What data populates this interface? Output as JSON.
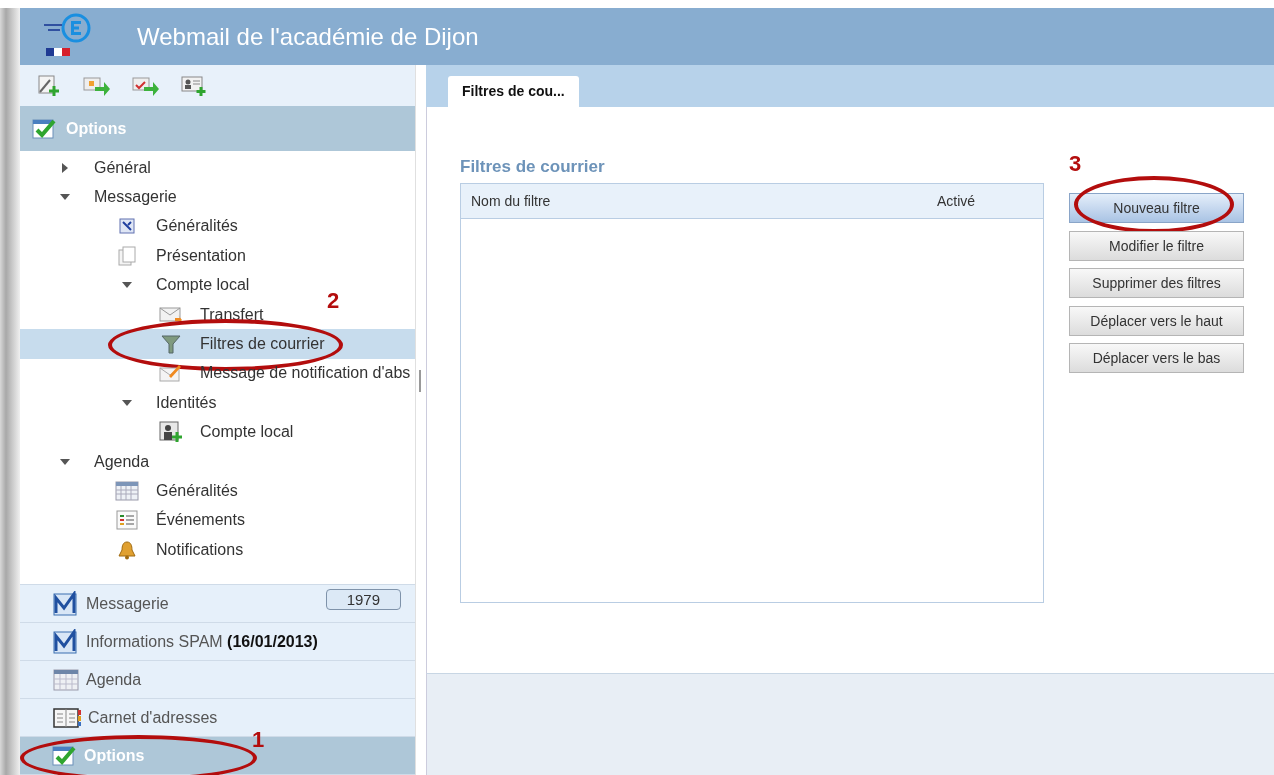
{
  "header": {
    "title": "Webmail de l'académie de Dijon"
  },
  "panel": {
    "title": "Options"
  },
  "tree": [
    {
      "label": "Général",
      "kind": "section",
      "expanded": false,
      "selected": false
    },
    {
      "label": "Messagerie",
      "kind": "section",
      "expanded": true,
      "selected": false,
      "children": [
        {
          "label": "Généralités",
          "kind": "settings",
          "selected": false
        },
        {
          "label": "Présentation",
          "kind": "pages",
          "selected": false
        },
        {
          "label": "Compte local",
          "kind": "section",
          "expanded": true,
          "selected": false,
          "children": [
            {
              "label": "Transfert",
              "kind": "forward",
              "selected": false
            },
            {
              "label": "Filtres de courrier",
              "kind": "filter",
              "selected": true,
              "annotation": "2"
            },
            {
              "label": "Message de notification d'abs",
              "kind": "note",
              "selected": false
            }
          ]
        },
        {
          "label": "Identités",
          "kind": "section",
          "expanded": true,
          "selected": false,
          "children": [
            {
              "label": "Compte local",
              "kind": "identity",
              "selected": false
            }
          ]
        }
      ]
    },
    {
      "label": "Agenda",
      "kind": "section",
      "expanded": true,
      "selected": false,
      "children": [
        {
          "label": "Généralités",
          "kind": "calendar",
          "selected": false
        },
        {
          "label": "Événements",
          "kind": "events",
          "selected": false
        },
        {
          "label": "Notifications",
          "kind": "bell",
          "selected": false
        }
      ]
    }
  ],
  "nav": [
    {
      "label": "Messagerie",
      "kind": "mail",
      "selected": false,
      "badge": "1979"
    },
    {
      "label": "Informations SPAM **(16/01/2013)**",
      "kind": "mail",
      "selected": false
    },
    {
      "label": "Agenda",
      "kind": "calendar",
      "selected": false
    },
    {
      "label": "Carnet d'adresses",
      "kind": "book",
      "selected": false
    },
    {
      "label": "Options",
      "kind": "check",
      "selected": true,
      "annotation": "1"
    }
  ],
  "tabs": [
    {
      "label": "Filtres de cou...",
      "selected": true
    }
  ],
  "content": {
    "title": "Filtres de courrier",
    "table": {
      "columns": [
        "Nom du filtre",
        "Activé"
      ]
    },
    "buttons": [
      {
        "label": "Nouveau filtre",
        "selected": true,
        "annotation": "3"
      },
      {
        "label": "Modifier le filtre",
        "selected": false
      },
      {
        "label": "Supprimer des filtres",
        "selected": false
      },
      {
        "label": "Déplacer vers le haut",
        "selected": false
      },
      {
        "label": "Déplacer vers le bas",
        "selected": false
      }
    ]
  }
}
